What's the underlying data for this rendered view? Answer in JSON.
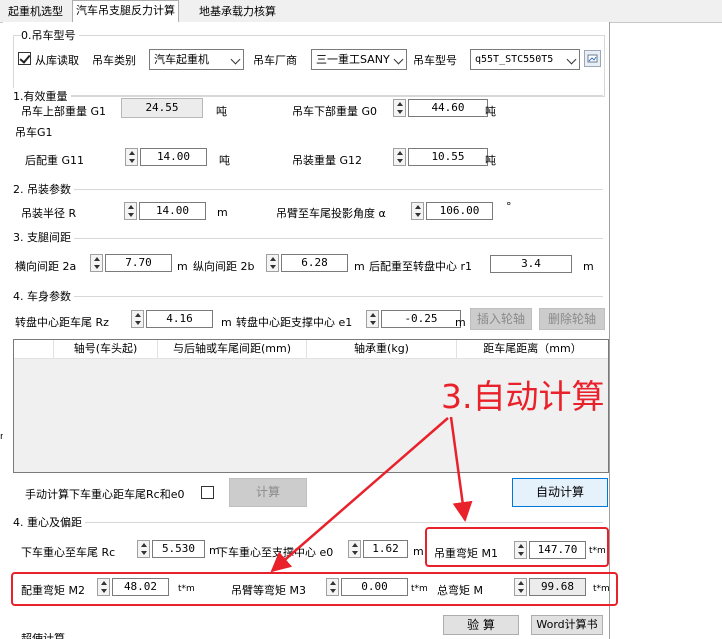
{
  "tabs": [
    "起重机选型",
    "汽车吊支腿反力计算",
    "地基承载力核算"
  ],
  "active_tab": 1,
  "s0": {
    "title": "0.吊车型号",
    "from_lib": "从库读取",
    "type_label": "吊车类别",
    "type_value": "汽车起重机",
    "maker_label": "吊车厂商",
    "maker_value": "三一重工SANY",
    "model_label": "吊车型号",
    "model_value": "q55T_STC550T5"
  },
  "s1": {
    "title": "1.有效重量",
    "g1_label": "吊车上部重量 G1",
    "g1_value": "24.55",
    "g0_label": "吊车下部重量 G0",
    "g0_value": "44.60",
    "unit": "吨",
    "sub_title": "吊车G1",
    "g11_label": "后配重 G11",
    "g11_value": "14.00",
    "g12_label": "吊装重量 G12",
    "g12_value": "10.55"
  },
  "s2": {
    "title": "2. 吊装参数",
    "r_label": "吊装半径 R",
    "r_value": "14.00",
    "r_unit": "m",
    "alpha_label": "吊臂至车尾投影角度 α",
    "alpha_value": "106.00",
    "alpha_unit": "°"
  },
  "s3": {
    "title": "3. 支腿间距",
    "h_label": "横向间距 2a",
    "h_value": "7.70",
    "v_label": "纵向间距 2b",
    "v_value": "6.28",
    "r1_label": "后配重至转盘中心 r1",
    "r1_value": "3.4",
    "unit": "m"
  },
  "s4": {
    "title": "4. 车身参数",
    "rz_label": "转盘中心距车尾 Rz",
    "rz_value": "4.16",
    "e1_label": "转盘中心距支撑中心 e1",
    "e1_value": "-0.25",
    "unit": "m",
    "insert_axle": "插入轮轴",
    "delete_axle": "删除轮轴",
    "table_headers": [
      "轴号(车头起)",
      "与后轴或车尾间距(mm)",
      "轴承重(kg)",
      "距车尾距离（mm）"
    ],
    "manual_label": "手动计算下车重心距车尾Rc和e0",
    "calc_btn": "计算",
    "auto_btn": "自动计算"
  },
  "s5": {
    "title": "4. 重心及偏距",
    "rc_label": "下车重心至车尾 Rc",
    "rc_value": "5.530",
    "e0_label": "下车重心至支撑中心 e0",
    "e0_value": "1.62",
    "m1_label": "吊重弯矩 M1",
    "m1_value": "147.70",
    "m2_label": "配重弯矩 M2",
    "m2_value": "48.02",
    "m3_label": "吊臂等弯矩 M3",
    "m3_value": "0.00",
    "m_label": "总弯矩 M",
    "m_value": "99.68",
    "unit_m": "m",
    "unit_tm": "t*m"
  },
  "bottom": {
    "verify_btn": "验 算",
    "word_btn": "Word计算书",
    "section_cut": "超使计算"
  },
  "annotation": "3.自动计算",
  "colors": {
    "annotation": "#e8212b",
    "active_button_border": "#0078d7"
  }
}
